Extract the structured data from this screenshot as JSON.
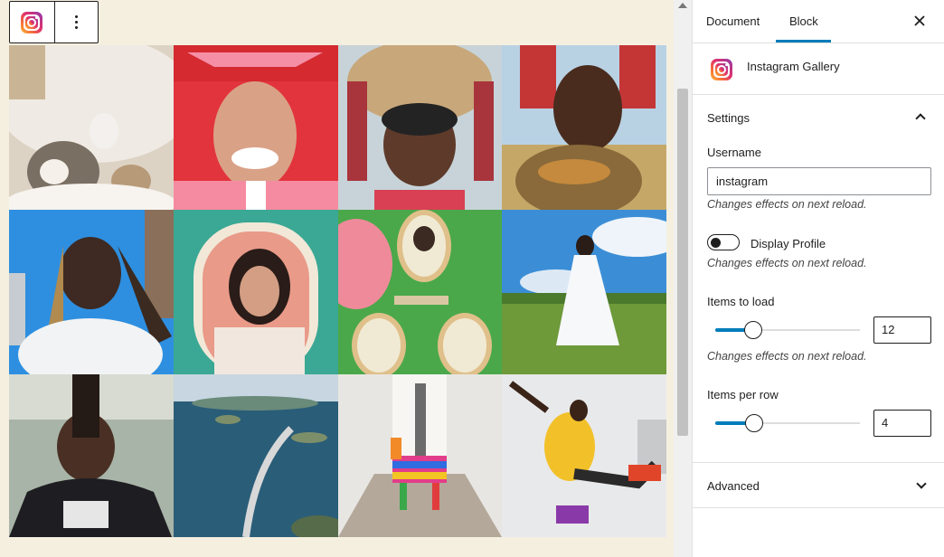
{
  "block_toolbar": {
    "block_icon": "instagram-icon",
    "options_icon": "kebab-menu-icon"
  },
  "gallery": {
    "photo_count": 12,
    "photos": [
      {
        "subject": "hedgehog-photo"
      },
      {
        "subject": "graduate-photo"
      },
      {
        "subject": "woven-headdress-photo"
      },
      {
        "subject": "woman-headwrap-photo"
      },
      {
        "subject": "braids-sky-photo"
      },
      {
        "subject": "pearl-frame-photo"
      },
      {
        "subject": "oval-portraits-photo"
      },
      {
        "subject": "white-dress-field-photo"
      },
      {
        "subject": "fence-portrait-photo"
      },
      {
        "subject": "ocean-bridge-photo"
      },
      {
        "subject": "rainbow-llama-photo"
      },
      {
        "subject": "roller-skater-photo"
      }
    ]
  },
  "sidebar": {
    "tabs": [
      {
        "label": "Document",
        "active": false
      },
      {
        "label": "Block",
        "active": true
      }
    ],
    "close_icon": "close-icon",
    "block_card": {
      "title": "Instagram Gallery",
      "icon": "instagram-icon"
    },
    "settings": {
      "title": "Settings",
      "expanded": true,
      "username_label": "Username",
      "username_value": "instagram",
      "username_help": "Changes effects on next reload.",
      "display_profile_label": "Display Profile",
      "display_profile_on": false,
      "display_profile_help": "Changes effects on next reload.",
      "items_to_load_label": "Items to load",
      "items_to_load_value": "12",
      "items_to_load_fraction": 0.26,
      "items_to_load_help": "Changes effects on next reload.",
      "items_per_row_label": "Items per row",
      "items_per_row_value": "4",
      "items_per_row_fraction": 0.27
    },
    "advanced": {
      "title": "Advanced",
      "expanded": false
    }
  },
  "colors": {
    "accent": "#007cba",
    "canvas_bg": "#f5efe0",
    "text": "#1e1e1e"
  }
}
